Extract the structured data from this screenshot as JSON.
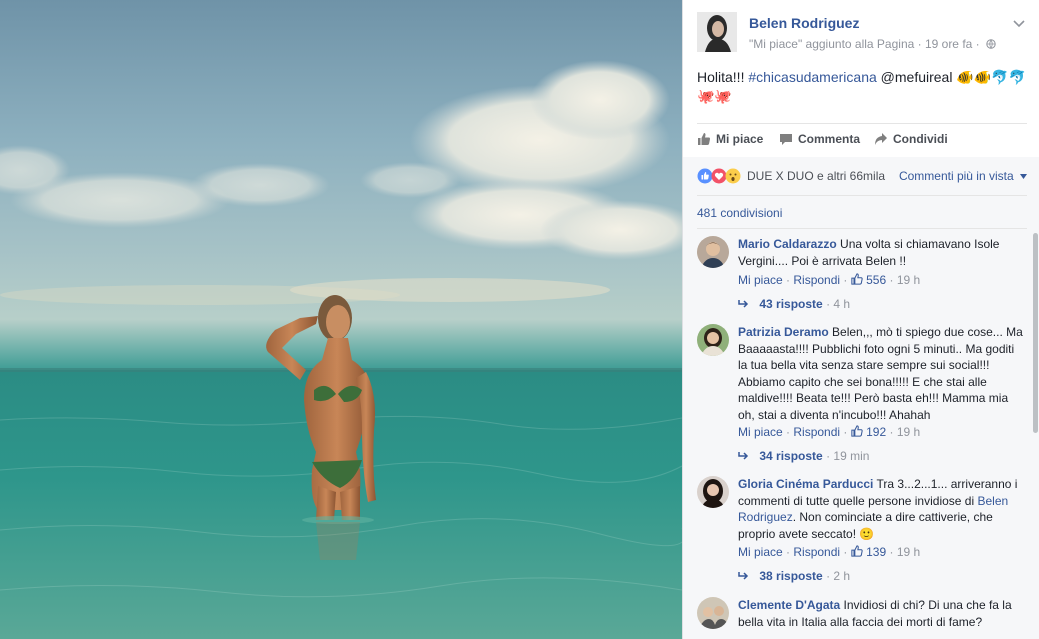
{
  "post": {
    "page_name": "Belen Rodriguez",
    "meta": "\"Mi piace\" aggiunto alla Pagina · 19 ore fa ·",
    "caption_text": "Holita!!! ",
    "caption_hashtag": "#chicasudamericana",
    "caption_mention": " @mefuireal ",
    "emoji_line1": "🐠🐠🐬🐬",
    "emoji_line2": "🐙🐙"
  },
  "actions": {
    "like": "Mi piace",
    "comment": "Commenta",
    "share": "Condividi"
  },
  "reactions": {
    "summary": "DUE X DUO e altri 66mila",
    "sort_label": "Commenti più in vista",
    "shares": "481 condivisioni"
  },
  "comments": [
    {
      "author": "Mario Caldarazzo",
      "text": " Una volta si chiamavano Isole Vergini.... Poi è arrivata Belen !!",
      "like": "Mi piace",
      "reply": "Rispondi",
      "likes": "556",
      "time": "19 h",
      "replies": "43 risposte",
      "replies_time": "4 h"
    },
    {
      "author": "Patrizia Deramo",
      "text": " Belen,,, mò ti spiego due cose... Ma Baaaaasta!!!! Pubblichi foto ogni 5 minuti.. Ma goditi la tua bella vita senza stare sempre sui social!!! Abbiamo capito che sei bona!!!!! E che stai alle maldive!!!! Beata te!!! Però basta eh!!! Mamma mia oh, stai a diventa n'incubo!!! Ahahah",
      "like": "Mi piace",
      "reply": "Rispondi",
      "likes": "192",
      "time": "19 h",
      "replies": "34 risposte",
      "replies_time": "19 min"
    },
    {
      "author": "Gloria Cinéma Parducci",
      "text": " Tra 3...2...1... arriveranno i commenti di tutte quelle persone invidiose di ",
      "mention": "Belen Rodriguez",
      "text2": ". Non cominciate a dire cattiverie, che proprio avete seccato! 🙂",
      "like": "Mi piace",
      "reply": "Rispondi",
      "likes": "139",
      "time": "19 h",
      "replies": "38 risposte",
      "replies_time": "2 h"
    },
    {
      "author": "Clemente D'Agata",
      "text": " Invidiosi di chi? Di una che fa la bella vita in Italia alla faccia dei morti di fame?"
    }
  ],
  "colors": {
    "link": "#365899",
    "meta": "#90949c",
    "text": "#1d2129",
    "sky": "#8db0bf",
    "sea": "#2c8f86"
  },
  "icons": [
    "chevron-down-icon",
    "globe-icon",
    "thumbs-up-icon",
    "comment-icon",
    "share-icon",
    "like-reaction-icon",
    "love-reaction-icon",
    "wow-reaction-icon",
    "reply-arrow-icon"
  ]
}
